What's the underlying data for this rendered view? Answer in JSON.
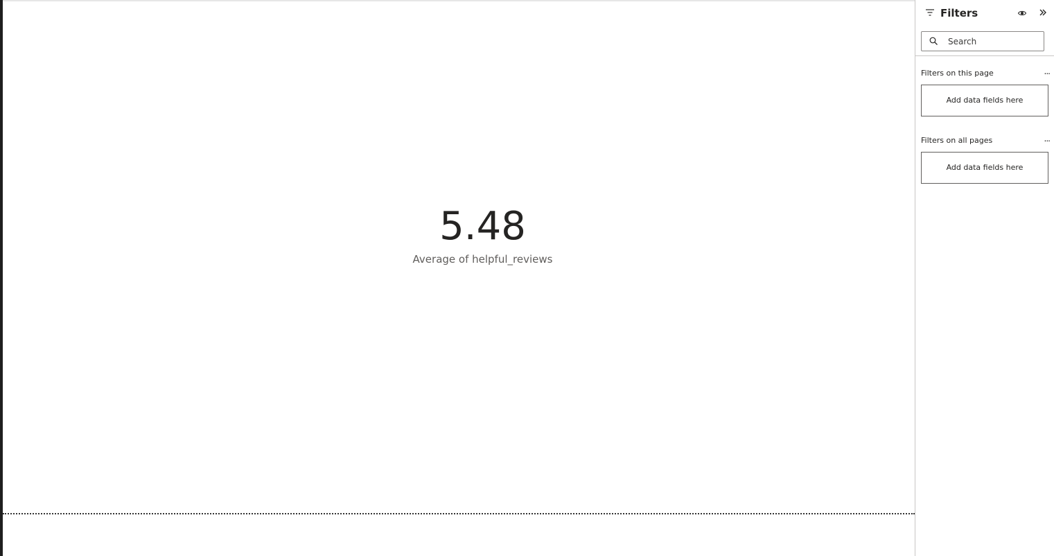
{
  "card": {
    "value": "5.48",
    "label": "Average of helpful_reviews"
  },
  "filters_pane": {
    "title": "Filters",
    "search": {
      "placeholder": "Search",
      "value": ""
    },
    "sections": [
      {
        "title": "Filters on this page",
        "more_label": "...",
        "drop_text": "Add data fields here"
      },
      {
        "title": "Filters on all pages",
        "more_label": "...",
        "drop_text": "Add data fields here"
      }
    ],
    "icons": {
      "filter": "filter-icon",
      "visibility": "eye-icon",
      "collapse": "chevron-double-right-icon",
      "search": "search-icon"
    }
  },
  "colors": {
    "text_primary": "#252423",
    "text_secondary": "#605e5c",
    "pane_border": "#c8c6c4"
  }
}
